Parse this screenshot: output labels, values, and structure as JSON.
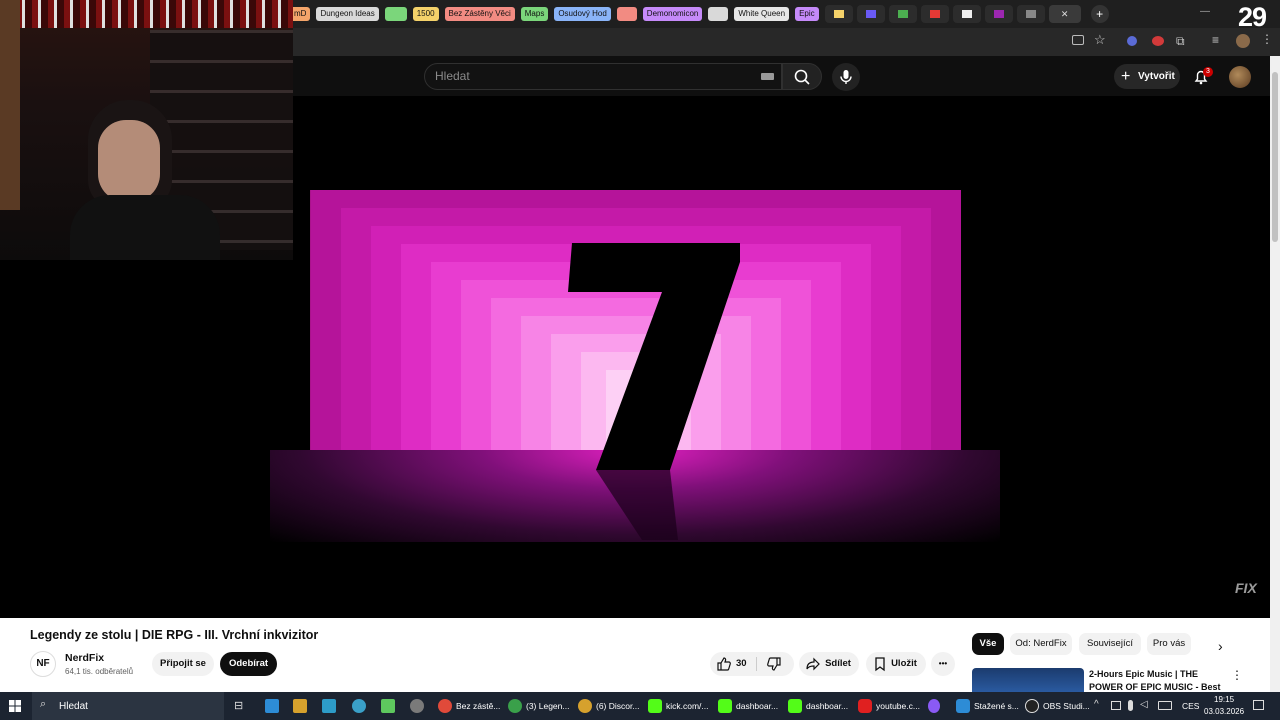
{
  "browser": {
    "tabs": [
      {
        "label": "mD",
        "color": "#f5a56a"
      },
      {
        "label": "Dungeon Ideas",
        "color": "#d9d9d9"
      },
      {
        "label": "",
        "color": "#7bd67b"
      },
      {
        "label": "1500",
        "color": "#f5d26a"
      },
      {
        "label": "Bez Zástěny Věci",
        "color": "#f28b82"
      },
      {
        "label": "Maps",
        "color": "#7bd67b"
      },
      {
        "label": "Osudový Hod",
        "color": "#8ab4f8"
      },
      {
        "label": "",
        "color": "#f28b82"
      },
      {
        "label": "Demonomicon",
        "color": "#c58af9"
      },
      {
        "label": "",
        "color": "#d9d9d9"
      },
      {
        "label": "White Queen",
        "color": "#e6e6e6"
      },
      {
        "label": "Epic",
        "color": "#c58af9"
      }
    ],
    "counter": "29",
    "new_tab": "+"
  },
  "youtube": {
    "search_placeholder": "Hledat",
    "create_label": "Vytvořit",
    "notif_count": "3"
  },
  "video": {
    "big_number": "7",
    "watermark": "FIX"
  },
  "info": {
    "title": "Legendy ze stolu | DIE RPG - III. Vrchní inkvizitor",
    "channel_logo": "NF",
    "channel": "NerdFix",
    "subs": "64,1 tis. odběratelů",
    "join": "Připojit se",
    "subscribe": "Odebírat",
    "likes": "30",
    "share": "Sdílet",
    "save": "Uložit",
    "more": "•••"
  },
  "chips": [
    "Vše",
    "Od: NerdFix",
    "Související",
    "Pro vás"
  ],
  "recommended": {
    "title_line1": "2-Hours Epic Music | THE",
    "title_line2": "POWER OF EPIC MUSIC - Best ..."
  },
  "taskbar": {
    "search": "Hledat",
    "items": [
      "Bez zástě...",
      "(3) Legen...",
      "(6) Discor...",
      "kick.com/...",
      "dashboar...",
      "dashboar...",
      "youtube.c...",
      "Stažené s...",
      "OBS Studi..."
    ],
    "lang": "CES",
    "time": "19:15",
    "date": "03.03.2026"
  }
}
